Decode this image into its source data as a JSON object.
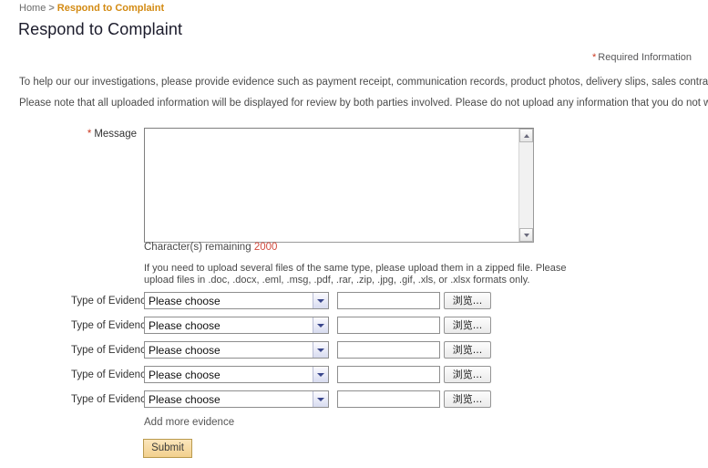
{
  "breadcrumb": {
    "home_label": "Home",
    "separator": ">",
    "current_label": "Respond to Complaint"
  },
  "page": {
    "title": "Respond to Complaint"
  },
  "required_note": {
    "star": "*",
    "text": "Required Information"
  },
  "intro": {
    "line1": "To help our our investigations, please provide evidence such as payment receipt, communication records, product photos, delivery slips, sales contract, etc.",
    "line2": "Please note that all uploaded information will be displayed for review by both parties involved. Please do not upload any information that you do not want the other party to see."
  },
  "message": {
    "star": "*",
    "label": "Message",
    "value": "",
    "placeholder": ""
  },
  "char_counter": {
    "label": "Character(s) remaining",
    "count": "2000"
  },
  "upload_hint": {
    "text": "If you need to upload several files of the same type, please upload them in a zipped file. Please upload files in .doc, .docx, .eml, .msg, .pdf, .rar, .zip, .jpg, .gif, .xls, or .xlsx formats only."
  },
  "evidence": {
    "rows": [
      {
        "label": "Type of Evidence",
        "select_value": "Please choose",
        "file_value": "",
        "browse_label": "浏览..."
      },
      {
        "label": "Type of Evidence",
        "select_value": "Please choose",
        "file_value": "",
        "browse_label": "浏览..."
      },
      {
        "label": "Type of Evidence",
        "select_value": "Please choose",
        "file_value": "",
        "browse_label": "浏览..."
      },
      {
        "label": "Type of Evidence",
        "select_value": "Please choose",
        "file_value": "",
        "browse_label": "浏览..."
      },
      {
        "label": "Type of Evidence",
        "select_value": "Please choose",
        "file_value": "",
        "browse_label": "浏览..."
      }
    ],
    "add_more_label": "Add more evidence"
  },
  "submit": {
    "label": "Submit"
  },
  "colors": {
    "breadcrumb_current": "#d38a12",
    "required_star": "#cc3a22",
    "counter_value": "#d24b3e",
    "submit_bg": "#f5d79b"
  }
}
